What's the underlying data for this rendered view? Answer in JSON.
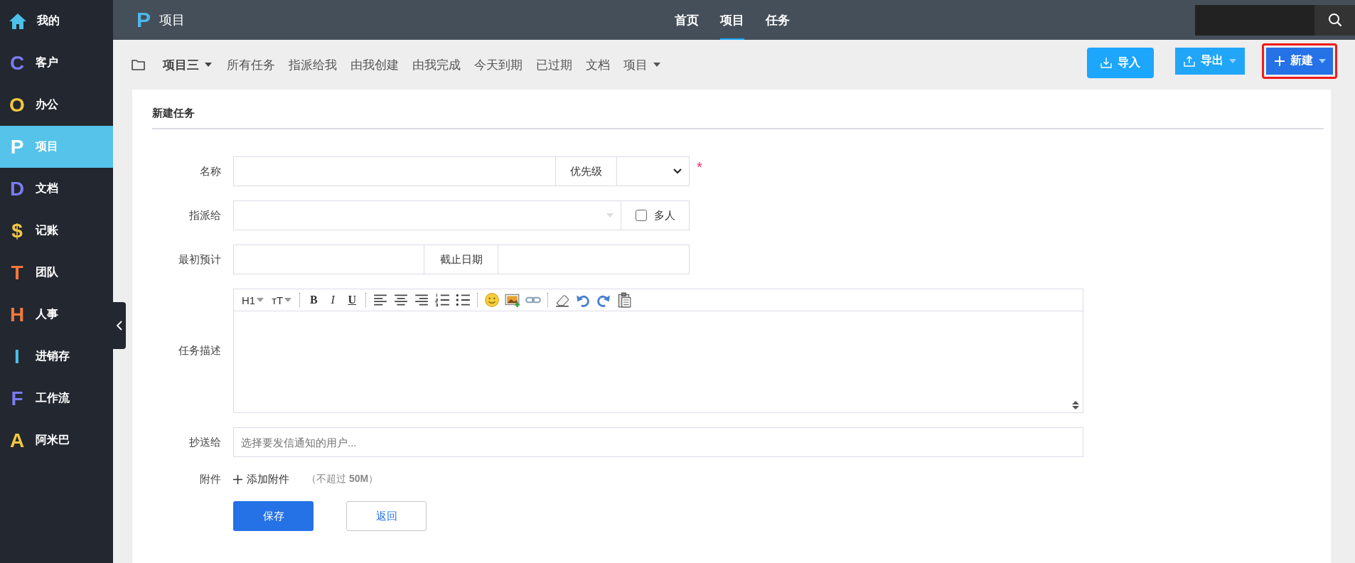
{
  "sidebar": {
    "items": [
      {
        "kind": "home",
        "label": "我的",
        "color": "#4cc0e8",
        "selected": false
      },
      {
        "kind": "letter",
        "letter": "C",
        "label": "客户",
        "color": "#7b7bf0",
        "selected": false
      },
      {
        "kind": "letter",
        "letter": "O",
        "label": "办公",
        "color": "#f2c840",
        "selected": false
      },
      {
        "kind": "letter",
        "letter": "P",
        "label": "项目",
        "color": "#ffffff",
        "selected": true
      },
      {
        "kind": "letter",
        "letter": "D",
        "label": "文档",
        "color": "#7b7bf0",
        "selected": false
      },
      {
        "kind": "letter",
        "letter": "$",
        "label": "记账",
        "color": "#f2c840",
        "selected": false
      },
      {
        "kind": "letter",
        "letter": "T",
        "label": "团队",
        "color": "#f5783c",
        "selected": false
      },
      {
        "kind": "letter",
        "letter": "H",
        "label": "人事",
        "color": "#f5783c",
        "selected": false
      },
      {
        "kind": "letter",
        "letter": "I",
        "label": "进销存",
        "color": "#4cc0e8",
        "selected": false
      },
      {
        "kind": "letter",
        "letter": "F",
        "label": "工作流",
        "color": "#7b7bf0",
        "selected": false
      },
      {
        "kind": "letter",
        "letter": "A",
        "label": "阿米巴",
        "color": "#f2c840",
        "selected": false
      }
    ]
  },
  "header": {
    "logo_letter": "P",
    "title": "项目",
    "nav": [
      {
        "label": "首页",
        "selected": false
      },
      {
        "label": "项目",
        "selected": true
      },
      {
        "label": "任务",
        "selected": false
      }
    ]
  },
  "subnav": {
    "project_menu": "项目三",
    "links": [
      {
        "label": "所有任务",
        "kind": "link"
      },
      {
        "label": "指派给我",
        "kind": "link"
      },
      {
        "label": "由我创建",
        "kind": "link"
      },
      {
        "label": "由我完成",
        "kind": "link"
      },
      {
        "label": "今天到期",
        "kind": "link"
      },
      {
        "label": "已过期",
        "kind": "link"
      },
      {
        "label": "文档",
        "kind": "link"
      },
      {
        "label": "项目",
        "kind": "menu"
      }
    ],
    "actions": [
      {
        "label": "导入",
        "kind": "import",
        "highlighted": false
      },
      {
        "label": "导出",
        "kind": "export",
        "highlighted": false
      },
      {
        "label": "新建",
        "kind": "new",
        "highlighted": true
      }
    ]
  },
  "form": {
    "title": "新建任务",
    "name_label": "名称",
    "priority_label": "优先级",
    "required_mark": "*",
    "assignee_label": "指派给",
    "multi_label": "多人",
    "multi_checked": false,
    "estimate_label": "最初预计",
    "deadline_label": "截止日期",
    "description_label": "任务描述",
    "editor_tools": [
      {
        "kind": "menu",
        "label": "H1"
      },
      {
        "kind": "menu",
        "label": "ᴛT"
      },
      {
        "kind": "separator"
      },
      {
        "kind": "bold",
        "label": "B"
      },
      {
        "kind": "italic",
        "label": "I"
      },
      {
        "kind": "underline",
        "label": "U"
      },
      {
        "kind": "separator"
      },
      {
        "kind": "align-left"
      },
      {
        "kind": "align-center"
      },
      {
        "kind": "align-right"
      },
      {
        "kind": "ordered-list"
      },
      {
        "kind": "unordered-list"
      },
      {
        "kind": "separator"
      },
      {
        "kind": "emoji"
      },
      {
        "kind": "image"
      },
      {
        "kind": "link"
      },
      {
        "kind": "separator"
      },
      {
        "kind": "eraser"
      },
      {
        "kind": "undo"
      },
      {
        "kind": "redo"
      },
      {
        "kind": "paste"
      }
    ],
    "cc_label": "抄送给",
    "cc_placeholder": "选择要发信通知的用户...",
    "attachment_label": "附件",
    "add_attachment": "添加附件",
    "attachment_note": "（不超过 **50M**）",
    "buttons": [
      {
        "label": "保存",
        "kind": "primary"
      },
      {
        "label": "返回",
        "kind": "secondary"
      }
    ]
  }
}
